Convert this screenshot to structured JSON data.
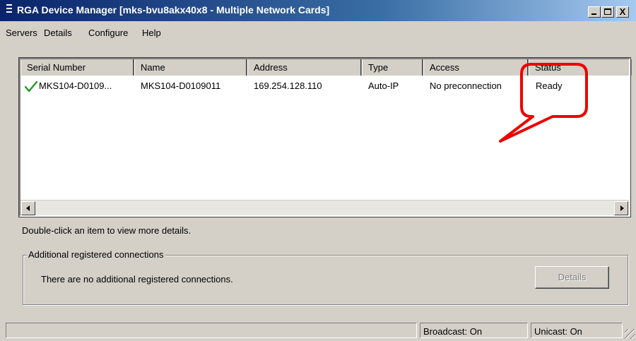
{
  "window": {
    "title": "RGA Device Manager [mks-bvu8akx40x8 - Multiple Network Cards]",
    "minimize_label": "",
    "maximize_label": "",
    "close_label": "X"
  },
  "menu": [
    "Servers",
    "Details",
    "Configure",
    "Help"
  ],
  "list": {
    "columns": [
      "Serial Number",
      "Name",
      "Address",
      "Type",
      "Access",
      "Status"
    ],
    "rows": [
      {
        "status_icon": "green-check-icon",
        "serial": "MKS104-D0109...",
        "name": "MKS104-D0109011",
        "address": "169.254.128.110",
        "type": "Auto-IP",
        "access": "No preconnection",
        "status": "Ready"
      }
    ]
  },
  "hint": "Double-click an item to view more details.",
  "group": {
    "label": "Additional registered connections",
    "message": "There are no additional registered connections.",
    "details_button": "Details"
  },
  "statusbar": {
    "broadcast": "Broadcast: On",
    "unicast": "Unicast: On"
  },
  "colors": {
    "callout": "#ee0000",
    "check": "#1f9a1f",
    "titlebar": "#0a246a"
  }
}
